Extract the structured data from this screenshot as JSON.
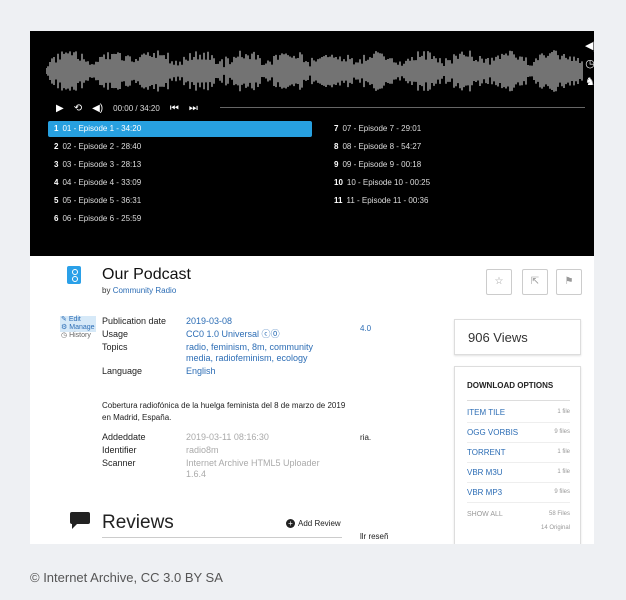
{
  "player": {
    "time": "00:00 / 34:20",
    "tracks_left": [
      {
        "num": "1",
        "label": "01 - Episode 1 - 34:20",
        "active": true
      },
      {
        "num": "2",
        "label": "02 - Episode 2 - 28:40"
      },
      {
        "num": "3",
        "label": "03 - Episode 3 - 28:13"
      },
      {
        "num": "4",
        "label": "04 - Episode 4 - 33:09"
      },
      {
        "num": "5",
        "label": "05 - Episode 5 - 36:31"
      },
      {
        "num": "6",
        "label": "06 - Episode 6 - 25:59"
      }
    ],
    "tracks_right": [
      {
        "num": "7",
        "label": "07 - Episode 7 - 29:01"
      },
      {
        "num": "8",
        "label": "08 - Episode 8 - 54:27"
      },
      {
        "num": "9",
        "label": "09 - Episode 9 - 00:18"
      },
      {
        "num": "10",
        "label": "10 - Episode 10 - 00:25"
      },
      {
        "num": "11",
        "label": "11 - Episode 11 - 00:36"
      }
    ]
  },
  "item": {
    "title": "Our Podcast",
    "by": "by",
    "creator": "Community Radio"
  },
  "edit_panel": {
    "edit": "Edit",
    "manage": "Manage",
    "history": "History"
  },
  "fields": {
    "pub_date_label": "Publication date",
    "pub_date": "2019-03-08",
    "usage_label": "Usage",
    "usage": "CC0 1.0 Universal",
    "topics_label": "Topics",
    "topics": "radio, feminism, 8m, community media, radiofeminism, ecology",
    "language_label": "Language",
    "language": "English"
  },
  "description": "Cobertura radiofónica de la huelga feminista del 8 de marzo de 2019 en Madrid, España.",
  "meta": {
    "addeddate_label": "Addeddate",
    "addeddate": "2019-03-11 08:16:30",
    "identifier_label": "Identifier",
    "identifier": "radio8m",
    "scanner_label": "Scanner",
    "scanner": "Internet Archive HTML5 Uploader 1.6.4"
  },
  "cutoff": {
    "c1": "4.0",
    "c2": "ria.",
    "c3": "llr reseñ"
  },
  "reviews": {
    "title": "Reviews",
    "add": "Add Review"
  },
  "views": "906 Views",
  "downloads": {
    "title": "DOWNLOAD OPTIONS",
    "rows": [
      {
        "name": "ITEM TILE",
        "count": "1 file"
      },
      {
        "name": "OGG VORBIS",
        "count": "9 files"
      },
      {
        "name": "TORRENT",
        "count": "1 file"
      },
      {
        "name": "VBR M3U",
        "count": "1 file"
      },
      {
        "name": "VBR MP3",
        "count": "9 files"
      }
    ],
    "show_all": "SHOW ALL",
    "files": "58 Files",
    "original": "14 Original"
  },
  "caption": "© Internet Archive, CC 3.0 BY SA"
}
